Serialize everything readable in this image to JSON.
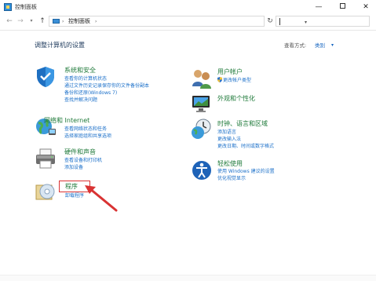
{
  "window": {
    "title": "控制面板",
    "minimize": "—",
    "close": "✕"
  },
  "nav": {
    "back": "←",
    "forward": "→",
    "recent": "▾",
    "up": "↑",
    "crumb_sep": "›",
    "crumb": "控制面板",
    "dropdown": "▾",
    "refresh": "↻"
  },
  "header": {
    "title": "调整计算机的设置",
    "view_by_label": "查看方式:",
    "view_by_value": "类别",
    "view_caret": "▾"
  },
  "categories": [
    {
      "title": "系统和安全",
      "links": [
        "查看你的计算机状态",
        "通过文件历史记录保存你的文件备份副本",
        "备份和还原(Windows 7)",
        "查找并解决问题"
      ]
    },
    {
      "title": "网络和 Internet",
      "links": [
        "查看网络状态和任务",
        "选择家庭组和共享选项"
      ]
    },
    {
      "title": "硬件和声音",
      "links": [
        "查看设备和打印机",
        "添加设备"
      ]
    },
    {
      "title": "程序",
      "links": [
        "卸载程序"
      ]
    },
    {
      "title": "用户帐户",
      "links": [
        "更改帐户类型"
      ]
    },
    {
      "title": "外观和个性化",
      "links": []
    },
    {
      "title": "时钟、语言和区域",
      "links": [
        "添加语言",
        "更改输入法",
        "更改日期、时间或数字格式"
      ]
    },
    {
      "title": "轻松使用",
      "links": [
        "使用 Windows 建议的设置",
        "优化视觉显示"
      ]
    }
  ],
  "colors": {
    "title_green": "#1f7a3a",
    "link_blue": "#1a6fc9",
    "highlight": "#d93333"
  }
}
